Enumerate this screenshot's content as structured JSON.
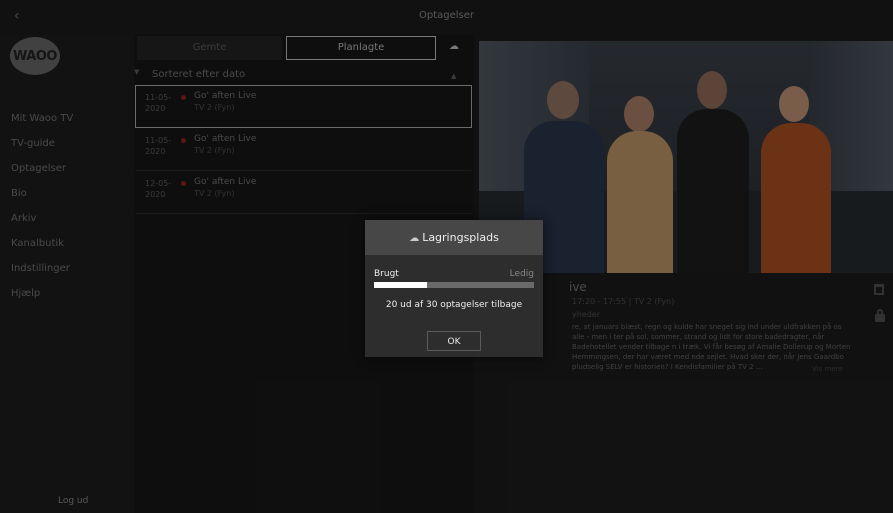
{
  "window": {
    "title": "Optagelser",
    "back_icon": "chevron-left-icon"
  },
  "sidebar": {
    "logo": "WAOO",
    "items": [
      {
        "label": "Mit Waoo TV"
      },
      {
        "label": "TV-guide"
      },
      {
        "label": "Optagelser"
      },
      {
        "label": "Bio"
      },
      {
        "label": "Arkiv"
      },
      {
        "label": "Kanalbutik"
      },
      {
        "label": "Indstillinger"
      },
      {
        "label": "Hjælp"
      }
    ],
    "logout": "Log ud"
  },
  "recordings": {
    "tabs": [
      {
        "label": "Gemte"
      },
      {
        "label": "Planlagte"
      }
    ],
    "cloud_icon": "cloud-icon",
    "sort_label": "Sorteret efter dato",
    "items": [
      {
        "date": "11-05-2020",
        "title": "Go' aften Live",
        "channel": "TV 2 (Fyn)"
      },
      {
        "date": "11-05-2020",
        "title": "Go' aften Live",
        "channel": "TV 2 (Fyn)"
      },
      {
        "date": "12-05-2020",
        "title": "Go' aften Live",
        "channel": "TV 2 (Fyn)"
      }
    ]
  },
  "detail": {
    "title": "ive",
    "time": "17:20 - 17:55 | TV 2 (Fyn)",
    "genre": "yheder",
    "description": "re, at januars blæst, regn og kulde har sneget sig ind under uldfrakken på os alle - men i ter på sol, sommer, strand og lidt for store badedragter, når Badehotellet vender tilbage n i træk. Vi får besøg af Amalie Dollerup og Morten Hemmingsen, der har været med nde sejlet. Hvad sker der, når Jens Gaardbo pludselig SELV er historien? I Kendisfamilier på TV 2 ...",
    "read_more": "Vis mere",
    "icons": [
      "trash-icon",
      "lock-icon"
    ]
  },
  "dialog": {
    "title": "Lagringsplads",
    "used_label": "Brugt",
    "free_label": "Ledig",
    "used_fraction": 0.333,
    "message": "20 ud af 30 optagelser tilbage",
    "ok_label": "OK"
  }
}
